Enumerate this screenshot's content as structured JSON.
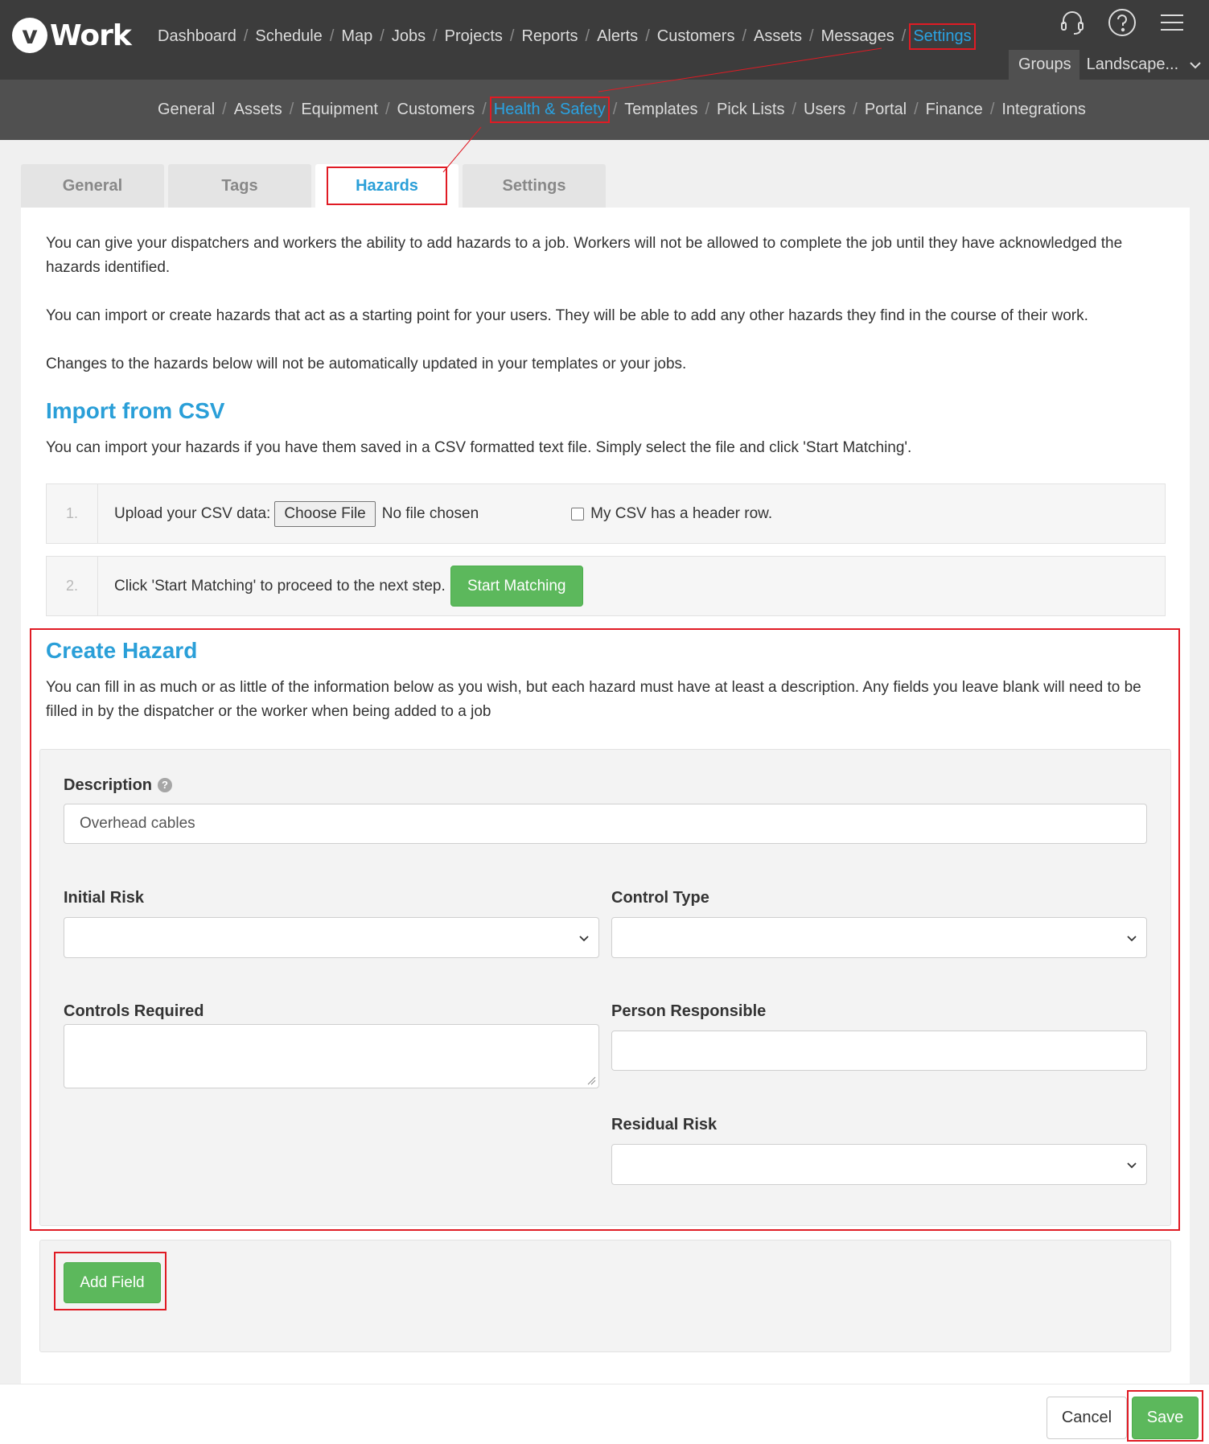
{
  "brand": {
    "logo_letter": "v",
    "logo_text": "Work"
  },
  "main_nav": {
    "items": [
      "Dashboard",
      "Schedule",
      "Map",
      "Jobs",
      "Projects",
      "Reports",
      "Alerts",
      "Customers",
      "Assets",
      "Messages",
      "Settings"
    ],
    "active": "Settings"
  },
  "top_icons": [
    "headset-icon",
    "help-icon",
    "menu-icon"
  ],
  "group_bar": {
    "groups_label": "Groups",
    "selected_group": "Landscape..."
  },
  "sub_nav": {
    "items": [
      "General",
      "Assets",
      "Equipment",
      "Customers",
      "Health & Safety",
      "Templates",
      "Pick Lists",
      "Users",
      "Portal",
      "Finance",
      "Integrations"
    ],
    "active": "Health & Safety"
  },
  "tabs": {
    "items": [
      "General",
      "Tags",
      "Hazards",
      "Settings"
    ],
    "active": "Hazards"
  },
  "intro": {
    "p1": "You can give your dispatchers and workers the ability to add hazards to a job. Workers will not be allowed to complete the job until they have acknowledged the hazards identified.",
    "p2": "You can import or create hazards that act as a starting point for your users. They will be able to add any other hazards they find in the course of their work.",
    "p3": "Changes to the hazards below will not be automatically updated in your templates or your jobs."
  },
  "import": {
    "title": "Import from CSV",
    "description": "You can import your hazards if you have them saved in a CSV formatted text file. Simply select the file and click 'Start Matching'.",
    "step1": {
      "num": "1.",
      "label": "Upload your CSV data:",
      "file_button": "Choose File",
      "file_status": "No file chosen",
      "header_checkbox_label": "My CSV has a header row.",
      "header_checked": false
    },
    "step2": {
      "num": "2.",
      "label": "Click 'Start Matching' to proceed to the next step.",
      "button": "Start Matching"
    }
  },
  "create": {
    "title": "Create Hazard",
    "description": "You can fill in as much or as little of the information below as you wish, but each hazard must have at least a description. Any fields you leave blank will need to be filled in by the dispatcher or the worker when being added to a job",
    "description_label": "Description",
    "description_value": "Overhead cables",
    "initial_risk_label": "Initial Risk",
    "initial_risk_value": "",
    "control_type_label": "Control Type",
    "control_type_value": "",
    "controls_required_label": "Controls Required",
    "controls_required_value": "",
    "person_responsible_label": "Person Responsible",
    "person_responsible_value": "",
    "residual_risk_label": "Residual Risk",
    "residual_risk_value": "",
    "add_field_button": "Add Field"
  },
  "footer": {
    "cancel": "Cancel",
    "save": "Save"
  },
  "colors": {
    "accent": "#2aa3e3",
    "success": "#5cb85c",
    "highlight": "#e01b24",
    "topbar": "#3c3c3c"
  }
}
